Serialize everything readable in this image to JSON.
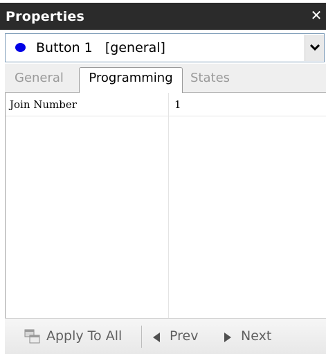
{
  "window": {
    "title": "Properties",
    "close_glyph": "✕"
  },
  "selector": {
    "icon": "blue-dot-icon",
    "icon_color": "#0000e6",
    "value": "Button 1   [general]"
  },
  "tabs": [
    {
      "label": "General",
      "active": false
    },
    {
      "label": "Programming",
      "active": true
    },
    {
      "label": "States",
      "active": false
    }
  ],
  "grid": {
    "rows": [
      {
        "name": "Join Number",
        "value": "1"
      }
    ]
  },
  "toolbar": {
    "apply_label": "Apply To All",
    "prev_label": "Prev",
    "next_label": "Next"
  }
}
